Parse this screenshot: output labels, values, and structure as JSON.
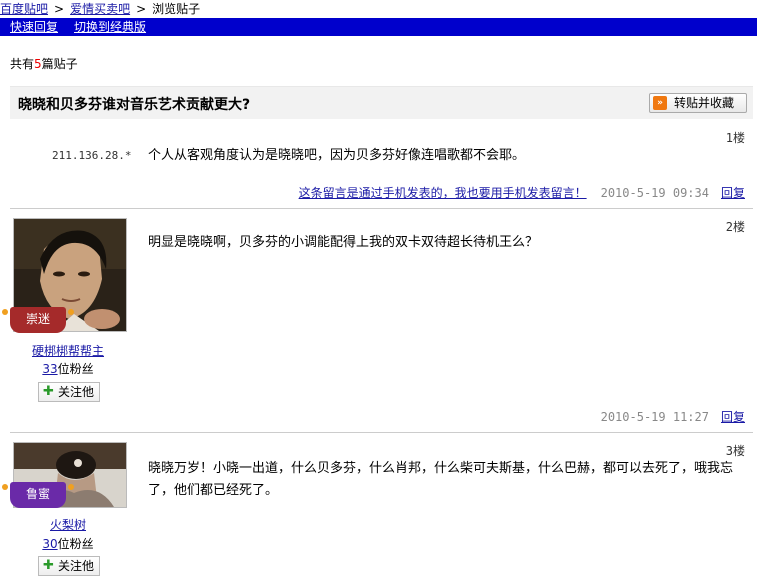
{
  "breadcrumb": {
    "home": "百度贴吧",
    "forum": "爱情买卖吧",
    "current": "浏览贴子",
    "sep": ">"
  },
  "toolbar": {
    "quick_reply": "快速回复",
    "classic": "切换到经典版"
  },
  "summary": {
    "prefix": "共有",
    "count": "5",
    "suffix": "篇贴子"
  },
  "thread": {
    "title": "晓晓和贝多芬谁对音乐艺术贡献更大?",
    "save_button": "转贴并收藏"
  },
  "posts": [
    {
      "floor": "1楼",
      "ip": "211.136.28.*",
      "content": "个人从客观角度认为是晓晓吧，因为贝多芬好像连唱歌都不会耶。",
      "mobile_link": "这条留言是通过手机发表的，我也要用手机发表留言！",
      "time": "2010-5-19 09:34",
      "reply": "回复"
    },
    {
      "floor": "2楼",
      "badge": "崇迷",
      "username": "硬梆梆帮帮主",
      "fans_count": "33",
      "fans_suffix": "位粉丝",
      "follow": "关注他",
      "content": "明显是晓晓啊，贝多芬的小调能配得上我的双卡双待超长待机王么？",
      "time": "2010-5-19 11:27",
      "reply": "回复"
    },
    {
      "floor": "3楼",
      "badge": "鲁蜜",
      "username": "火梨树",
      "fans_count": "30",
      "fans_suffix": "位粉丝",
      "follow": "关注他",
      "content": "晓晓万岁！小晓一出道，什么贝多芬，什么肖邦，什么柴可夫斯基，什么巴赫，都可以去死了，哦我忘了，他们都已经死了。"
    }
  ],
  "colors": {
    "link": "#1a1aa6",
    "bar": "#0000cc",
    "badge_red": "#a52a2a",
    "badge_purple": "#6a2aa8",
    "count_red": "#e00"
  }
}
